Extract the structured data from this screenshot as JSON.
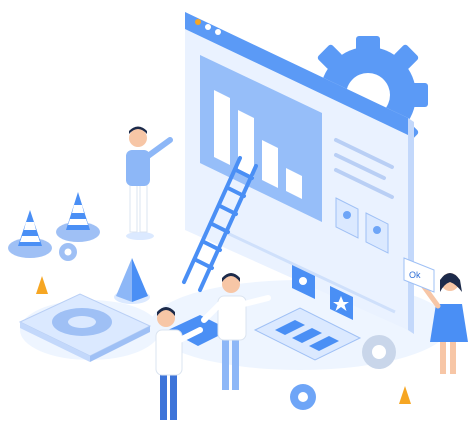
{
  "illustration": {
    "floating_note": {
      "text": "Ok"
    },
    "palette": {
      "primary": "#4a8ff5",
      "light": "#dbe9ff",
      "pale": "#eef5ff",
      "dark": "#1f4fa3",
      "shirt": "#ffffff",
      "pants": "#3d74d9",
      "skin": "#f7c6a6",
      "hair": "#1c2a4a"
    }
  }
}
